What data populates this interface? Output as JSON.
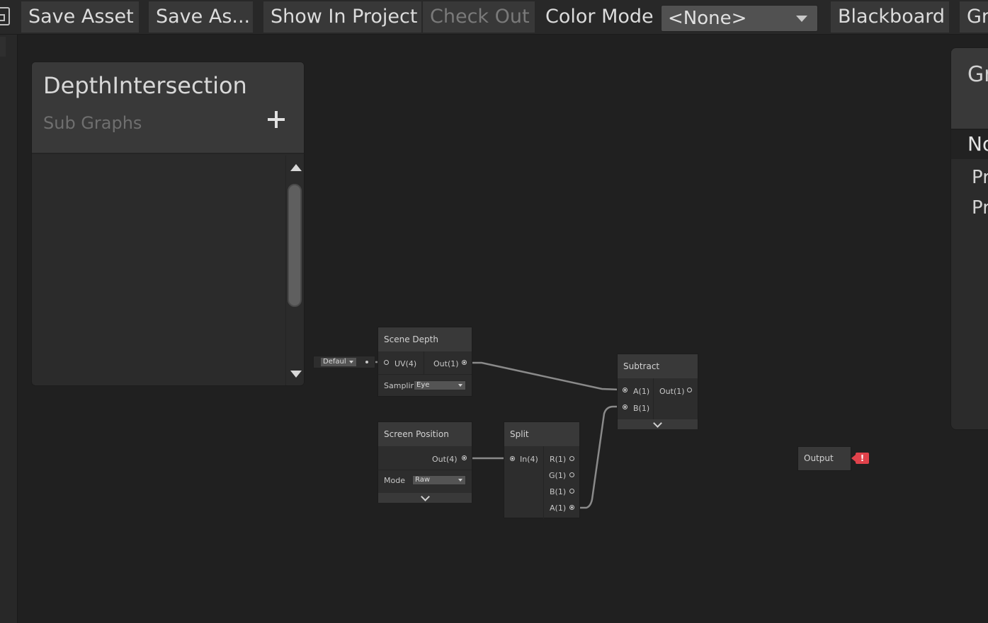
{
  "toolbar": {
    "save_asset": "Save Asset",
    "save_as": "Save As...",
    "show_in_project": "Show In Project",
    "check_out": "Check Out",
    "color_mode_label": "Color Mode",
    "color_mode_value": "<None>",
    "blackboard": "Blackboard",
    "graph_inspector_partial": "Gr"
  },
  "blackboard": {
    "title": "DepthIntersection",
    "subtitle": "Sub Graphs"
  },
  "inspector": {
    "title_partial": "Gr",
    "tab_partial": "No",
    "row1_partial": "Pr",
    "row2_partial": "Pr"
  },
  "graph": {
    "default_dropdown": "Defaul",
    "scene_depth": {
      "title": "Scene Depth",
      "input": "UV(4)",
      "output": "Out(1)",
      "sampling_label": "Samplin",
      "sampling_value": "Eye"
    },
    "subtract": {
      "title": "Subtract",
      "input_a": "A(1)",
      "input_b": "B(1)",
      "output": "Out(1)"
    },
    "screen_position": {
      "title": "Screen Position",
      "output": "Out(4)",
      "mode_label": "Mode",
      "mode_value": "Raw"
    },
    "split": {
      "title": "Split",
      "input": "In(4)",
      "out_r": "R(1)",
      "out_g": "G(1)",
      "out_b": "B(1)",
      "out_a": "A(1)"
    },
    "output": {
      "title": "Output",
      "error_glyph": "!"
    }
  }
}
